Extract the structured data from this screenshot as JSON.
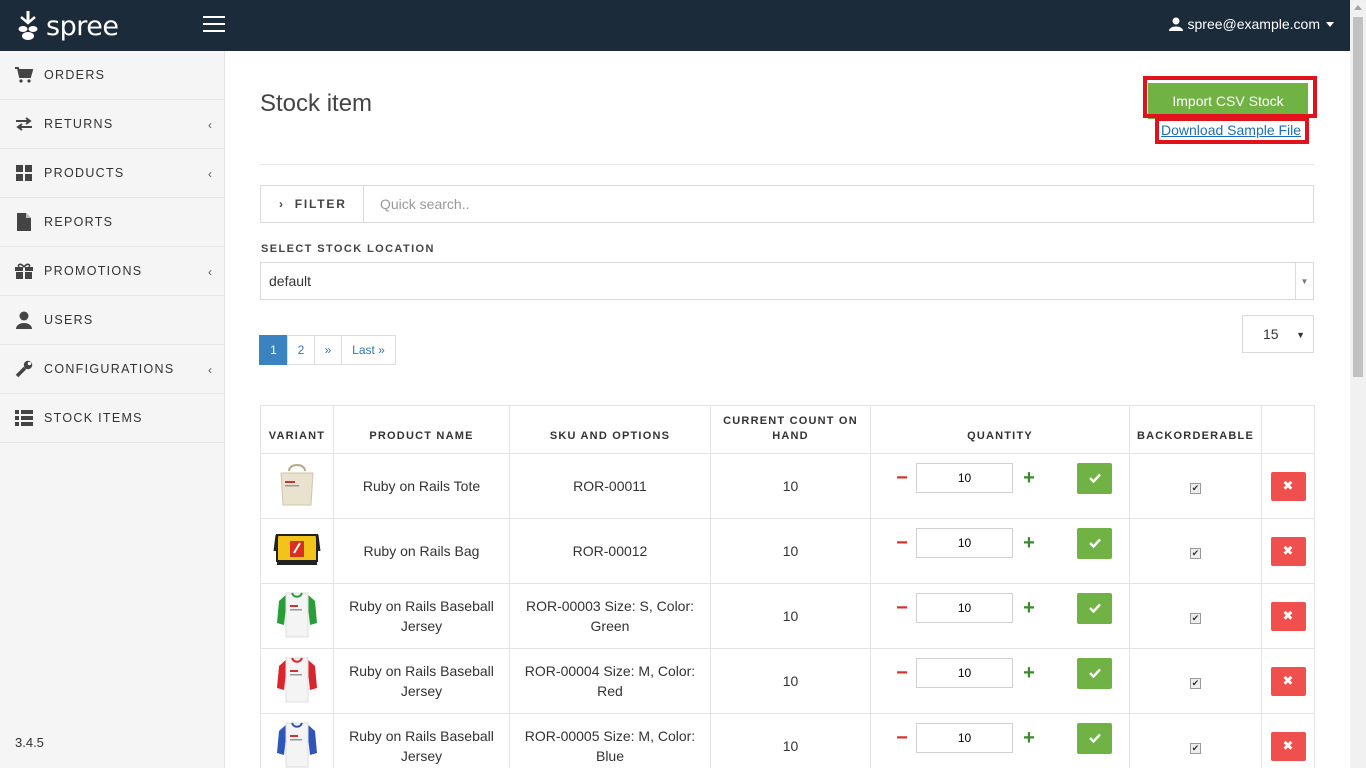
{
  "header": {
    "logo_text": "spree",
    "user_email": "spree@example.com"
  },
  "sidebar": {
    "items": [
      {
        "label": "ORDERS",
        "icon": "cart-icon",
        "has_chevron": false
      },
      {
        "label": "RETURNS",
        "icon": "exchange-icon",
        "has_chevron": true
      },
      {
        "label": "PRODUCTS",
        "icon": "grid-icon",
        "has_chevron": true
      },
      {
        "label": "REPORTS",
        "icon": "document-icon",
        "has_chevron": false
      },
      {
        "label": "PROMOTIONS",
        "icon": "gift-icon",
        "has_chevron": true
      },
      {
        "label": "USERS",
        "icon": "user-icon",
        "has_chevron": false
      },
      {
        "label": "CONFIGURATIONS",
        "icon": "wrench-icon",
        "has_chevron": true
      },
      {
        "label": "STOCK ITEMS",
        "icon": "list-icon",
        "has_chevron": false
      }
    ],
    "version": "3.4.5"
  },
  "main": {
    "title": "Stock item",
    "import_button": "Import CSV Stock",
    "download_link": "Download Sample File",
    "filter_label": "FILTER",
    "search_placeholder": "Quick search..",
    "location_label": "SELECT STOCK LOCATION",
    "location_value": "default",
    "pagination": [
      "1",
      "2",
      "»",
      "Last »"
    ],
    "per_page": "15"
  },
  "table": {
    "headers": [
      "VARIANT",
      "PRODUCT NAME",
      "SKU AND OPTIONS",
      "CURRENT COUNT ON HAND",
      "QUANTITY",
      "BACKORDERABLE",
      ""
    ],
    "rows": [
      {
        "product": "Ruby on Rails Tote",
        "sku": "ROR-00011",
        "count": "10",
        "qty": "10",
        "img": "tote"
      },
      {
        "product": "Ruby on Rails Bag",
        "sku": "ROR-00012",
        "count": "10",
        "qty": "10",
        "img": "bag"
      },
      {
        "product": "Ruby on Rails Baseball Jersey",
        "sku": "ROR-00003 Size: S, Color: Green",
        "count": "10",
        "qty": "10",
        "img": "jersey",
        "sleeve_color": "#2a9d3a"
      },
      {
        "product": "Ruby on Rails Baseball Jersey",
        "sku": "ROR-00004 Size: M, Color: Red",
        "count": "10",
        "qty": "10",
        "img": "jersey",
        "sleeve_color": "#d8262c"
      },
      {
        "product": "Ruby on Rails Baseball Jersey",
        "sku": "ROR-00005 Size: M, Color: Blue",
        "count": "10",
        "qty": "10",
        "img": "jersey",
        "sleeve_color": "#2f55b8"
      }
    ]
  },
  "colors": {
    "header_bg": "#1c2b3a",
    "accent_green": "#70b244",
    "danger_red": "#f0504d",
    "highlight_red": "#e0121c",
    "link_blue": "#1d6fb8"
  }
}
